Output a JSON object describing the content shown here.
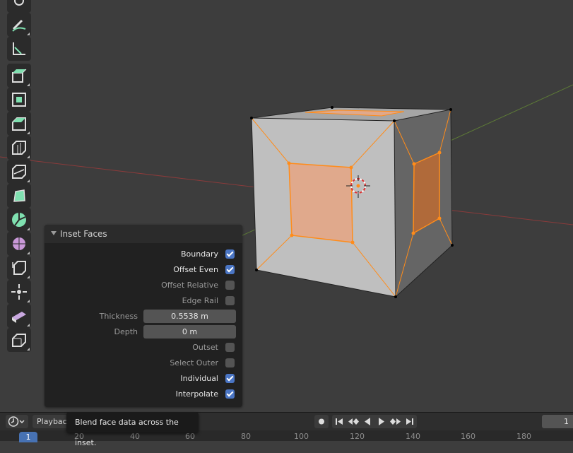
{
  "operator_panel": {
    "title": "Inset Faces",
    "options": [
      {
        "label": "Boundary",
        "checked": true,
        "enabled": true
      },
      {
        "label": "Offset Even",
        "checked": true,
        "enabled": true
      },
      {
        "label": "Offset Relative",
        "checked": false,
        "enabled": false
      },
      {
        "label": "Edge Rail",
        "checked": false,
        "enabled": false
      }
    ],
    "thickness": {
      "label": "Thickness",
      "value": "0.5538 m"
    },
    "depth": {
      "label": "Depth",
      "value": "0 m"
    },
    "options2": [
      {
        "label": "Outset",
        "checked": false,
        "enabled": false
      },
      {
        "label": "Select Outer",
        "checked": false,
        "enabled": false
      },
      {
        "label": "Individual",
        "checked": true,
        "enabled": true
      },
      {
        "label": "Interpolate",
        "checked": true,
        "enabled": true
      }
    ]
  },
  "timeline": {
    "playback_label": "Playback",
    "tooltip": "Blend face data across the inset.",
    "current_frame": "1",
    "frame_field": "1",
    "ticks": [
      "20",
      "40",
      "60",
      "80",
      "100",
      "120",
      "140",
      "160",
      "180"
    ]
  },
  "toolbar_tools": [
    "annotate-icon",
    "measure-icon",
    "extrude-region-icon",
    "inset-faces-icon",
    "bevel-icon",
    "loop-cut-icon",
    "knife-icon",
    "poly-build-icon",
    "spin-icon",
    "smooth-icon",
    "edge-slide-icon",
    "shrink-fatten-icon",
    "shear-icon",
    "rip-region-icon"
  ],
  "colors": {
    "accent": "#4a75c4",
    "selection": "#ff8c1a",
    "panel_bg": "#212121",
    "viewport_bg": "#3d3d3d"
  }
}
